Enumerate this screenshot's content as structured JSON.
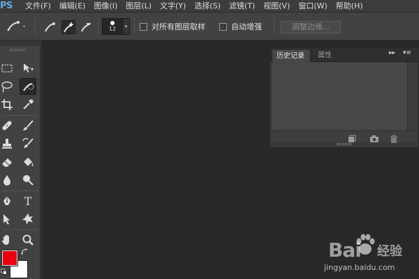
{
  "app": {
    "logo": "PS"
  },
  "menu": [
    {
      "label": "文件(F)"
    },
    {
      "label": "编辑(E)"
    },
    {
      "label": "图像(I)"
    },
    {
      "label": "图层(L)"
    },
    {
      "label": "文字(Y)"
    },
    {
      "label": "选择(S)"
    },
    {
      "label": "滤镜(T)"
    },
    {
      "label": "视图(V)"
    },
    {
      "label": "窗口(W)"
    },
    {
      "label": "帮助(H)"
    }
  ],
  "options": {
    "brush_size": "12",
    "sample_all_layers_label": "对所有图层取样",
    "auto_enhance_label": "自动增强",
    "refine_edge_label": "调整边缘..."
  },
  "history_panel": {
    "tab_history": "历史记录",
    "tab_properties": "属性",
    "expand_glyph": "▸▸",
    "menu_glyph": "▾≡"
  },
  "colors": {
    "foreground": "#e60012",
    "background": "#ffffff"
  },
  "watermark": {
    "brand": "Bai",
    "brand_cn": "经验",
    "url": "jingyan.baidu.com"
  }
}
